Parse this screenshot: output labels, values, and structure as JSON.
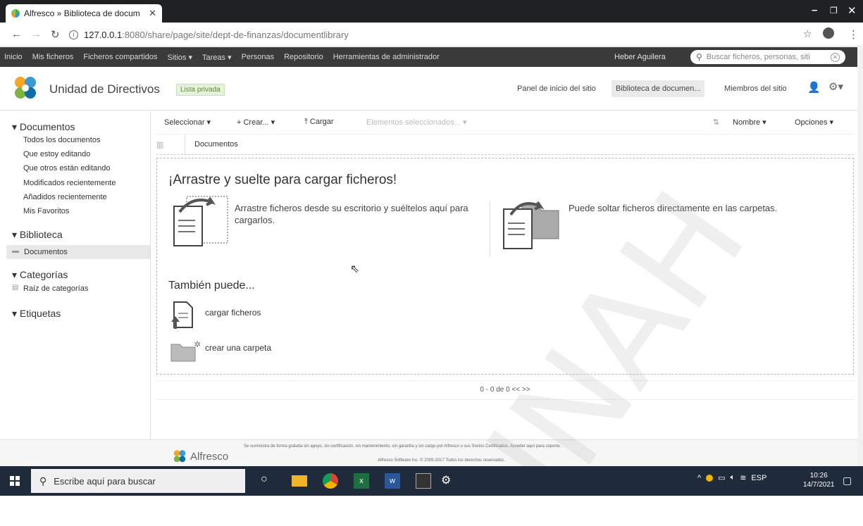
{
  "browser": {
    "tab_title": "Alfresco » Biblioteca de docum",
    "url_host": "127.0.0.1",
    "url_path": ":8080/share/page/site/dept-de-finanzas/documentlibrary"
  },
  "nav": {
    "items": [
      "Inicio",
      "Mis ficheros",
      "Ficheros compartidos",
      "Sitios ▾",
      "Tareas ▾",
      "Personas",
      "Repositorio",
      "Herramientas de administrador"
    ],
    "user": "Heber Aguilera",
    "search_placeholder": "Buscar ficheros, personas, siti"
  },
  "site": {
    "title": "Unidad de Directivos",
    "badge": "Lista privada",
    "links": [
      "Panel de inicio del sitio",
      "Biblioteca de documen...",
      "Miembros del sitio"
    ]
  },
  "sidebar": {
    "documentos": "▾ Documentos",
    "doc_links": [
      "Todos los documentos",
      "Que estoy editando",
      "Que otros están editando",
      "Modificados recientemente",
      "Añadidos recientemente",
      "Mis Favoritos"
    ],
    "biblioteca": "▾ Biblioteca",
    "biblioteca_item": "Documentos",
    "categorias": "▾ Categorías",
    "categorias_item": "Raíz de categorías",
    "etiquetas": "▾ Etiquetas"
  },
  "toolbar": {
    "select": "Seleccionar ▾",
    "create": "+ Crear... ▾",
    "upload": "⤒ Cargar",
    "selected_items": "Elementos seleccionados... ▾",
    "sort": "Nombre ▾",
    "options": "Opciones ▾"
  },
  "breadcrumb": "Documentos",
  "dropzone": {
    "title": "¡Arrastre y suelte para cargar ficheros!",
    "text1": "Arrastre ficheros desde su escritorio y suéltelos aquí para cargarlos.",
    "text2": "Puede soltar ficheros directamente en las carpetas.",
    "also": "También puede...",
    "action1": "cargar ficheros",
    "action2": "crear una carpeta"
  },
  "pager": "0 - 0 de 0   <<    >>",
  "footer": {
    "brand": "Alfresco",
    "line1": "Se suministra de forma gratuita sin apoyo, sin certificación, sin mantenimiento, sin garantía y sin cargo por Alfresco o sus Socios Certificados. Acceder aquí para soporte.",
    "line2": "Alfresco Software Inc. © 2005-2017 Todos los derechos reservados."
  },
  "taskbar": {
    "search": "Escribe aquí para buscar",
    "lang": "ESP",
    "time": "10:26",
    "date": "14/7/2021"
  },
  "watermark": "INAH"
}
